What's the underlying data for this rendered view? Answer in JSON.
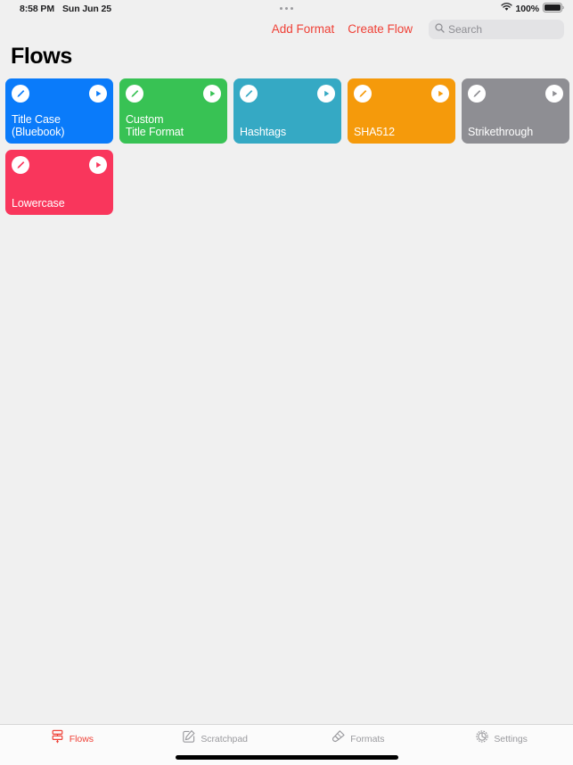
{
  "status_bar": {
    "time": "8:58 PM",
    "date": "Sun Jun 25",
    "battery_percent": "100%",
    "wifi_icon": "wifi-icon",
    "battery_icon": "battery-full-icon",
    "multitask_icon": "multitasking-dots-icon"
  },
  "nav": {
    "add_format_label": "Add Format",
    "create_flow_label": "Create Flow",
    "search_placeholder": "Search",
    "search_value": "",
    "search_icon": "search-icon",
    "accent_color": "#ef4036"
  },
  "page": {
    "title": "Flows"
  },
  "flows": [
    {
      "label": "Title Case\n(Bluebook)",
      "color": "#0a7bfa",
      "edit_icon": "pencil-icon",
      "run_icon": "play-icon"
    },
    {
      "label": "Custom\nTitle Format",
      "color": "#38c254",
      "edit_icon": "pencil-icon",
      "run_icon": "play-icon"
    },
    {
      "label": "Hashtags",
      "color": "#35a9c4",
      "edit_icon": "pencil-icon",
      "run_icon": "play-icon"
    },
    {
      "label": "SHA512",
      "color": "#f59a0b",
      "edit_icon": "pencil-icon",
      "run_icon": "play-icon"
    },
    {
      "label": "Strikethrough",
      "color": "#8e8e93",
      "edit_icon": "pencil-icon",
      "run_icon": "play-icon"
    },
    {
      "label": "Lowercase",
      "color": "#f9365c",
      "edit_icon": "pencil-icon",
      "run_icon": "play-icon"
    }
  ],
  "tab_bar": {
    "items": [
      {
        "label": "Flows",
        "icon": "flowchart-icon",
        "active": true
      },
      {
        "label": "Scratchpad",
        "icon": "compose-square-icon",
        "active": false
      },
      {
        "label": "Formats",
        "icon": "paintbrush-icon",
        "active": false
      },
      {
        "label": "Settings",
        "icon": "gear-icon",
        "active": false
      }
    ],
    "active_color": "#ef4036",
    "inactive_color": "#9a9a9e"
  }
}
